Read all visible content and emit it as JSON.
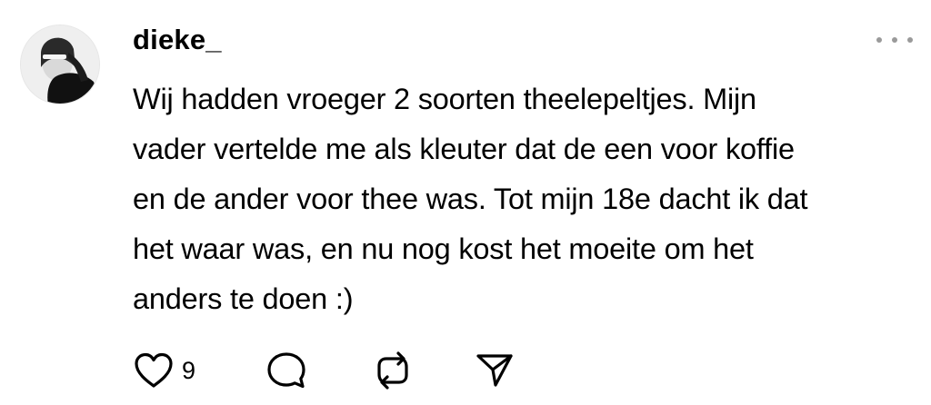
{
  "post": {
    "username": "dieke_",
    "lines": [
      "Wij hadden vroeger 2 soorten theelepeltjes. Mijn",
      "vader vertelde me als kleuter dat de een voor koffie",
      "en de ander voor thee was. Tot mijn 18e dacht ik dat",
      "het waar was, en nu nog kost het moeite om het",
      "anders te doen :)"
    ],
    "actions": {
      "like_icon": "heart-icon",
      "like_count": "9",
      "comment_icon": "comment-icon",
      "repost_icon": "repost-icon",
      "share_icon": "send-icon"
    },
    "more_icon": "more-horizontal-icon"
  }
}
